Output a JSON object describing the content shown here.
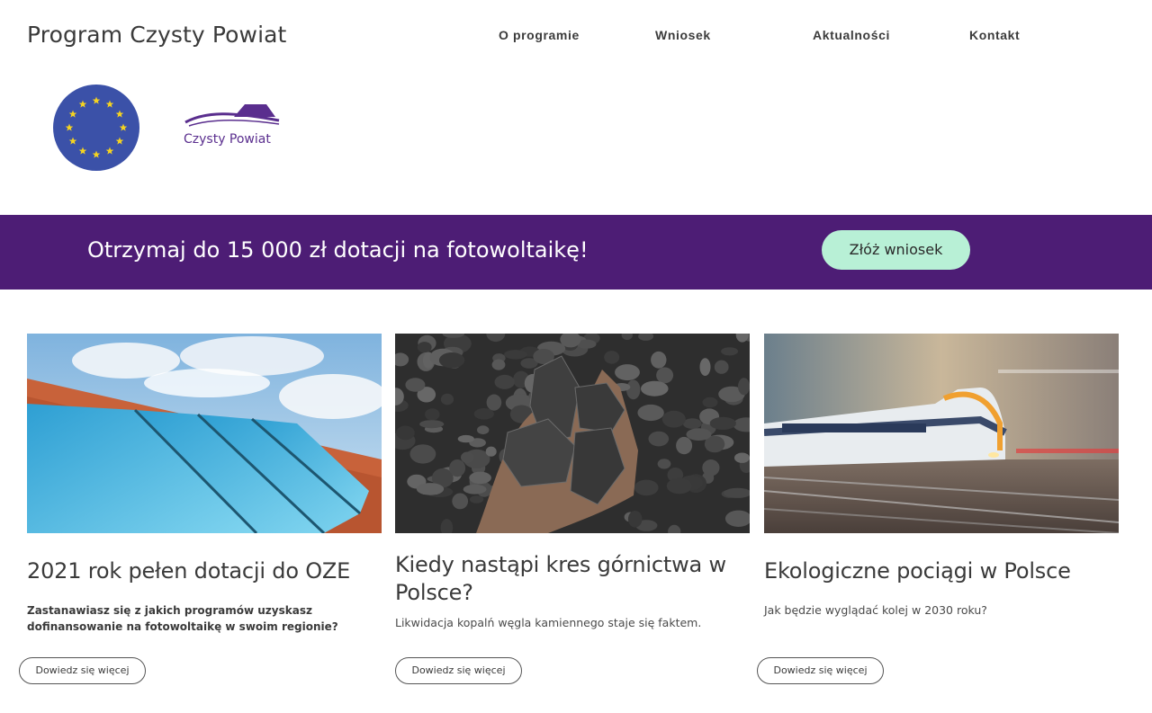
{
  "header": {
    "site_title": "Program Czysty Powiat",
    "nav": [
      "O programie",
      "Wniosek",
      "Aktualności",
      "Kontakt"
    ]
  },
  "logos": {
    "eu_icon": "eu-flag-icon",
    "cp_text": "Czysty Powiat"
  },
  "banner": {
    "text": "Otrzymaj do 15 000 zł dotacji na fotowoltaikę!",
    "button": "Złóż wniosek",
    "background": "#4d1d75",
    "button_color": "#b8f0d6"
  },
  "articles": [
    {
      "image": "solar-panels-roof",
      "title": "2021 rok pełen dotacji do OZE",
      "description": "Zastanawiasz się z jakich programów uzyskasz dofinansowanie na fotowoltaikę w swoim regionie?",
      "button": "Dowiedz się więcej"
    },
    {
      "image": "coal-in-hand",
      "title": "Kiedy nastąpi kres górnictwa w Polsce?",
      "description": "Likwidacja kopalń węgla kamiennego staje się faktem.",
      "button": "Dowiedz się więcej"
    },
    {
      "image": "high-speed-train",
      "title": "Ekologiczne pociągi w Polsce",
      "description": "Jak będzie wyglądać kolej w 2030 roku?",
      "button": "Dowiedz się więcej"
    }
  ]
}
